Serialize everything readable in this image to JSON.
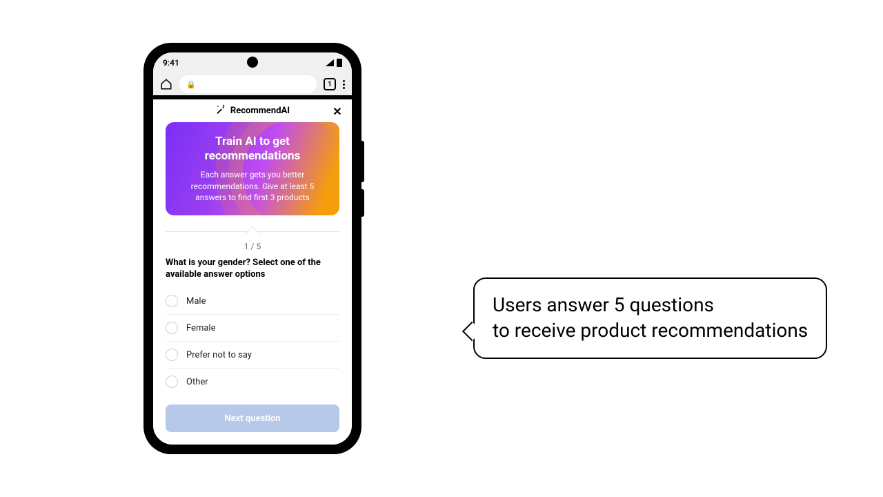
{
  "statusbar": {
    "time": "9:41"
  },
  "browser": {
    "tab_count": "1"
  },
  "app": {
    "title": "RecommendAI",
    "close_glyph": "✕",
    "hero": {
      "title": "Train AI to get recommendations",
      "subtitle": "Each answer gets you better recommendations. Give at least 5 answers to find first 3 products"
    },
    "progress": "1 / 5",
    "question": "What is your gender? Select one of the available answer options",
    "options": [
      {
        "label": "Male"
      },
      {
        "label": "Female"
      },
      {
        "label": "Prefer not to say"
      },
      {
        "label": "Other"
      }
    ],
    "next_label": "Next question"
  },
  "callout": {
    "text": "Users answer 5 questions\nto receive product recommendations"
  }
}
